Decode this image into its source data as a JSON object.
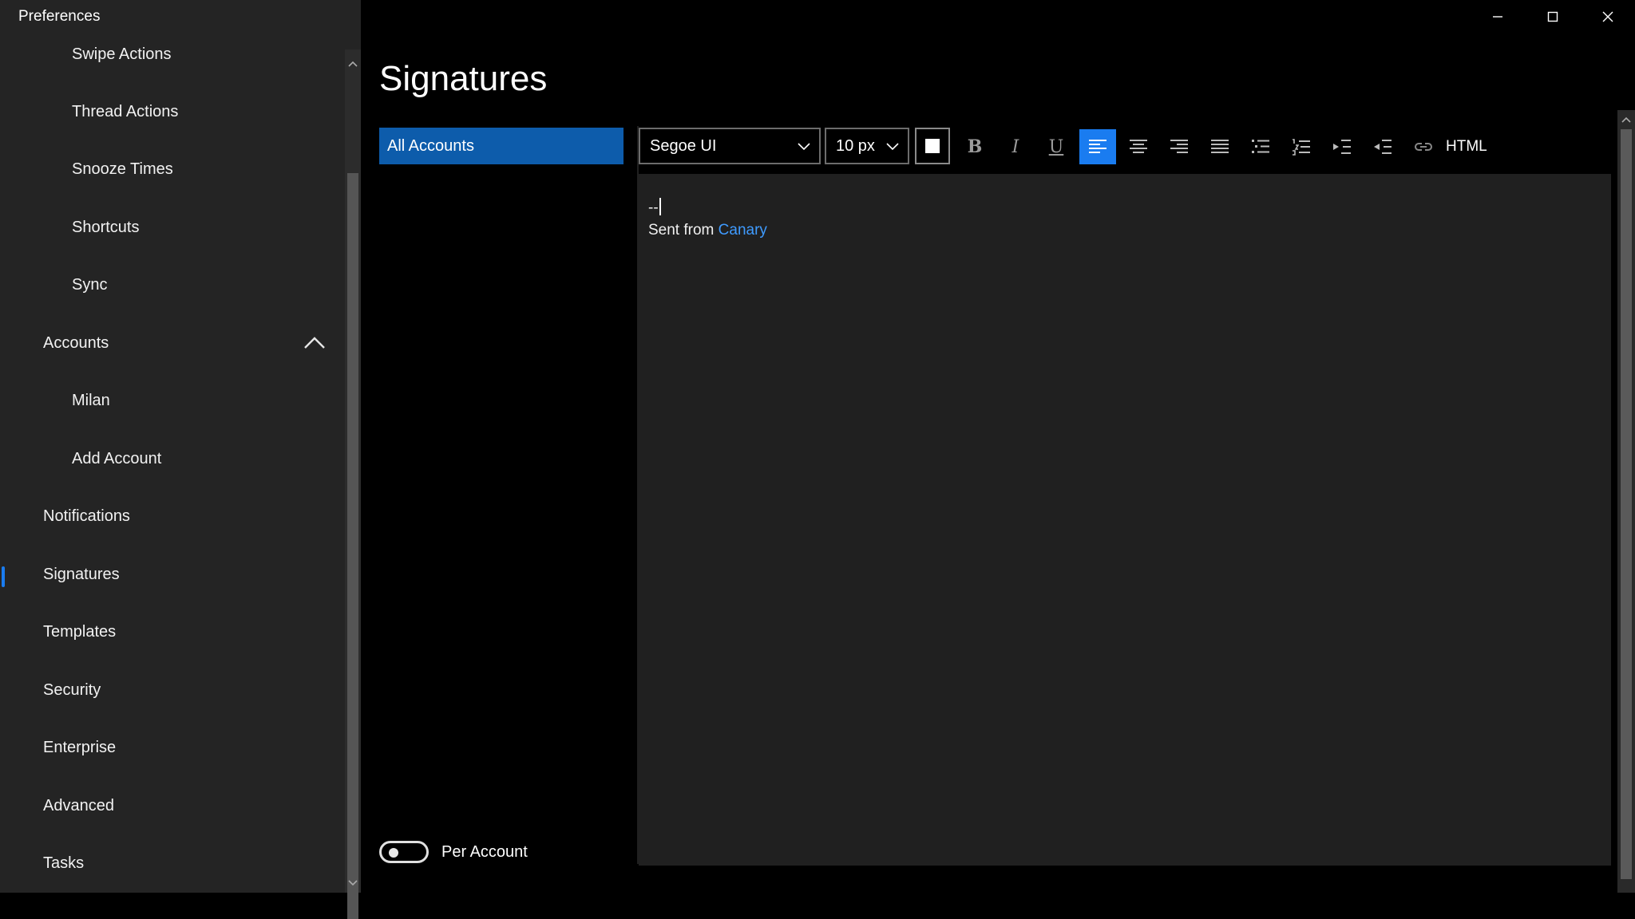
{
  "app": {
    "title": "Preferences"
  },
  "sidebar": {
    "items": [
      {
        "label": "Swipe Actions",
        "level": "sub"
      },
      {
        "label": "Thread Actions",
        "level": "sub"
      },
      {
        "label": "Snooze Times",
        "level": "sub"
      },
      {
        "label": "Shortcuts",
        "level": "sub"
      },
      {
        "label": "Sync",
        "level": "sub"
      },
      {
        "label": "Accounts",
        "level": "top",
        "expanded": true
      },
      {
        "label": "Milan",
        "level": "sub"
      },
      {
        "label": "Add Account",
        "level": "sub"
      },
      {
        "label": "Notifications",
        "level": "top"
      },
      {
        "label": "Signatures",
        "level": "top",
        "active": true
      },
      {
        "label": "Templates",
        "level": "top"
      },
      {
        "label": "Security",
        "level": "top"
      },
      {
        "label": "Enterprise",
        "level": "top"
      },
      {
        "label": "Advanced",
        "level": "top"
      },
      {
        "label": "Tasks",
        "level": "top"
      }
    ]
  },
  "window_controls": {
    "minimize_icon": "minimize-icon",
    "maximize_icon": "maximize-icon",
    "close_icon": "close-icon"
  },
  "main": {
    "title": "Signatures",
    "accounts": [
      {
        "label": "All Accounts",
        "selected": true
      }
    ],
    "per_account": {
      "label": "Per Account",
      "on": false
    }
  },
  "toolbar": {
    "font": "Segoe UI",
    "size": "10 px",
    "text_color": "#ffffff",
    "bold_glyph": "B",
    "italic_glyph": "I",
    "underline_glyph": "U",
    "html_label": "HTML",
    "active_align": "left"
  },
  "editor": {
    "line1": "--",
    "line2_prefix": "Sent from ",
    "link_text": "Canary"
  },
  "colors": {
    "accent": "#1a7cf0",
    "selected_account": "#0d5cab",
    "link": "#3f9bff",
    "sidebar_bg": "#242424",
    "editor_bg": "#202020"
  }
}
